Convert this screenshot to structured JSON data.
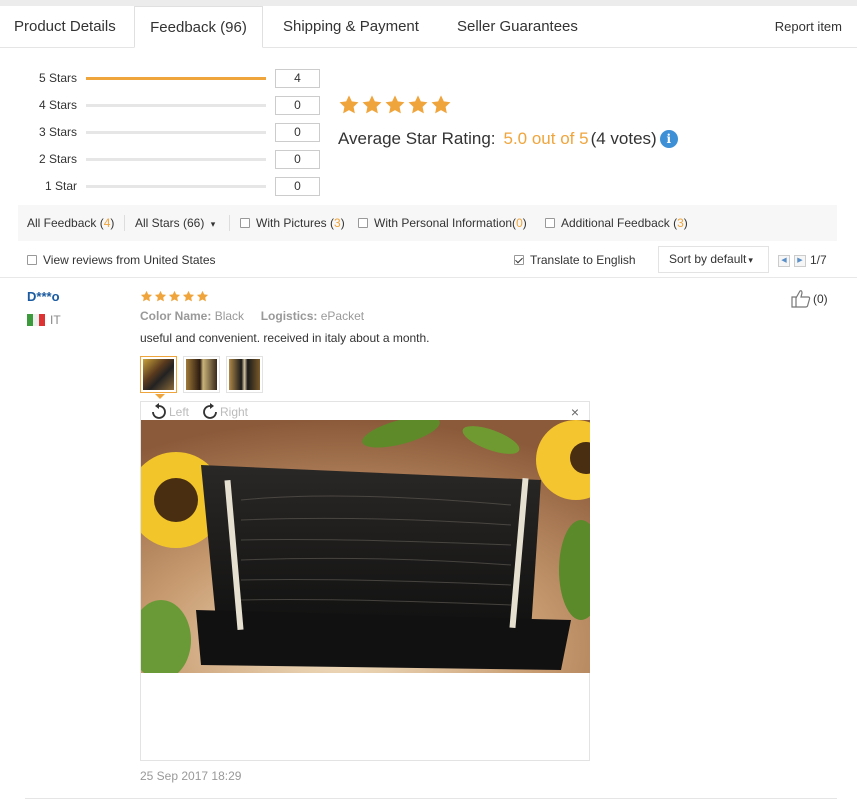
{
  "tabs": {
    "product_details": "Product Details",
    "feedback": "Feedback (96)",
    "shipping": "Shipping & Payment",
    "guarantees": "Seller Guarantees",
    "report": "Report item"
  },
  "rating_breakdown": [
    {
      "label": "5 Stars",
      "count": "4",
      "fill": 1.0
    },
    {
      "label": "4 Stars",
      "count": "0",
      "fill": 0
    },
    {
      "label": "3 Stars",
      "count": "0",
      "fill": 0
    },
    {
      "label": "2 Stars",
      "count": "0",
      "fill": 0
    },
    {
      "label": "1 Star",
      "count": "0",
      "fill": 0
    }
  ],
  "summary": {
    "label": "Average Star Rating:",
    "score": "5.0 out of 5",
    "votes": "(4 votes)",
    "stars_filled": 5
  },
  "filters": {
    "all_feedback": "All Feedback (",
    "all_feedback_count": "4",
    "all_stars": "All Stars (66)",
    "with_pictures": "With Pictures (",
    "with_pictures_count": "3",
    "personal_info": "With Personal Information(",
    "personal_info_count": "0",
    "additional": "Additional Feedback (",
    "additional_count": "3",
    "close_paren": ")"
  },
  "options": {
    "view_us": "View reviews from United States",
    "translate": "Translate to English",
    "sort": "Sort by default",
    "page": "1/7"
  },
  "review": {
    "name": "D***o",
    "country": "IT",
    "stars": 5,
    "color_label": "Color Name:",
    "color_value": "Black",
    "logistics_label": "Logistics:",
    "logistics_value": "ePacket",
    "comment": "useful and convenient. received in italy about a month.",
    "likes": "(0)",
    "rotate_left": "Left",
    "rotate_right": "Right",
    "close": "×",
    "date": "25 Sep 2017 18:29"
  },
  "colors": {
    "accent": "#f0a53c",
    "link": "#1a5aa0"
  }
}
